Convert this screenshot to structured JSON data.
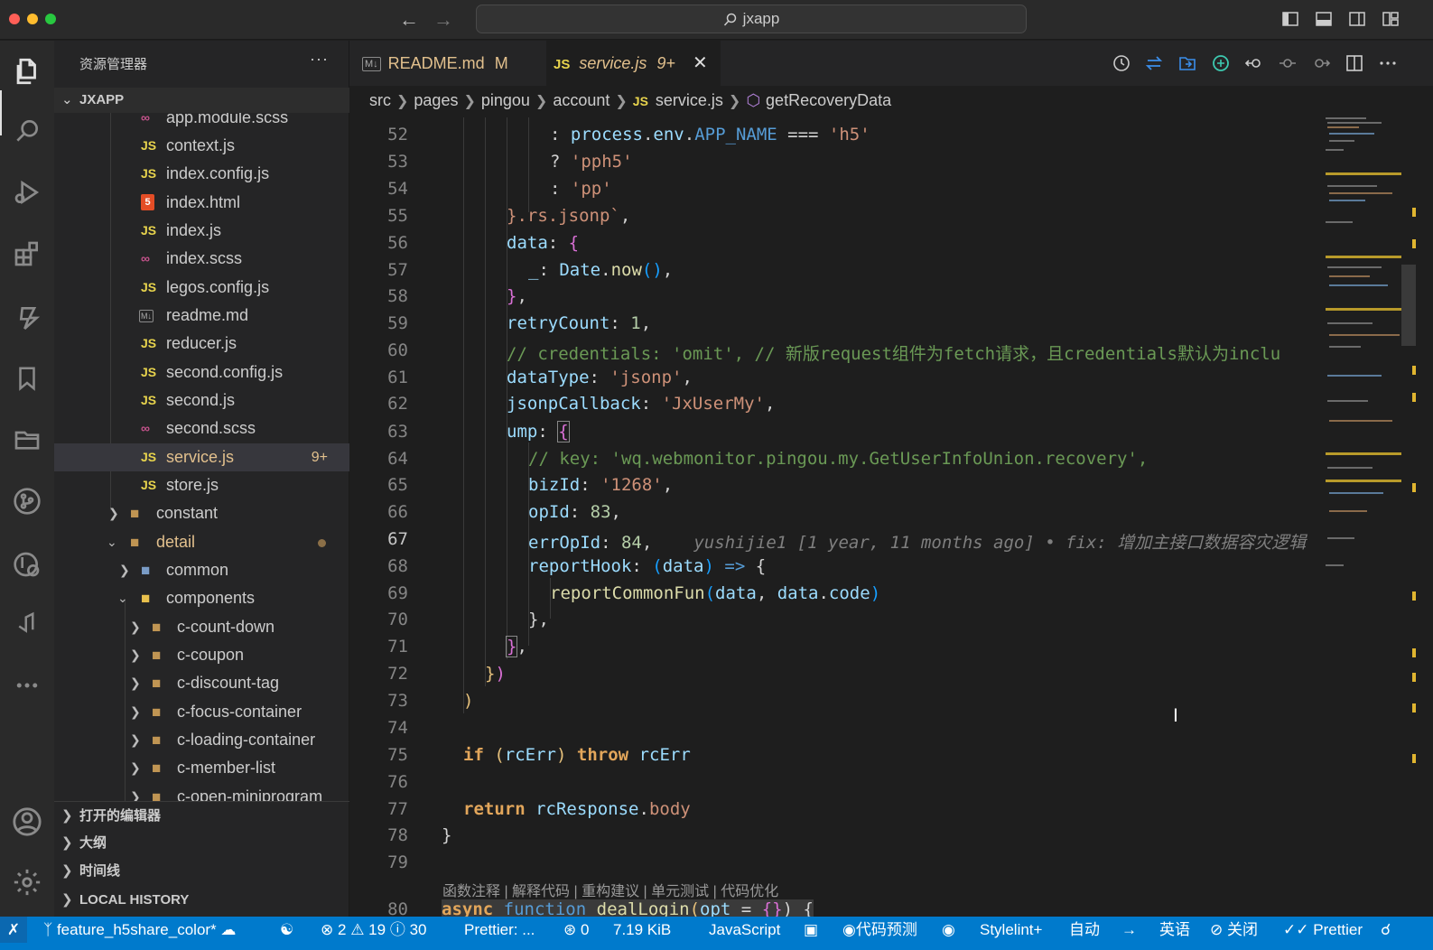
{
  "window": {
    "title": "jxapp"
  },
  "sidebar": {
    "title": "资源管理器",
    "more": "···",
    "root": "JXAPP",
    "tree": [
      {
        "label": "app.module.scss",
        "icon": "sass-icon"
      },
      {
        "label": "context.js",
        "icon": "js-file-icon",
        "icon_text": "JS"
      },
      {
        "label": "index.config.js",
        "icon": "js-file-icon",
        "icon_text": "JS"
      },
      {
        "label": "index.html",
        "icon": "html-file-icon"
      },
      {
        "label": "index.js",
        "icon": "js-file-icon",
        "icon_text": "JS"
      },
      {
        "label": "index.scss",
        "icon": "sass-icon"
      },
      {
        "label": "legos.config.js",
        "icon": "js-file-icon",
        "icon_text": "JS"
      },
      {
        "label": "readme.md",
        "icon": "markdown-icon"
      },
      {
        "label": "reducer.js",
        "icon": "js-file-icon",
        "icon_text": "JS"
      },
      {
        "label": "second.config.js",
        "icon": "js-file-icon",
        "icon_text": "JS"
      },
      {
        "label": "second.js",
        "icon": "js-file-icon",
        "icon_text": "JS"
      },
      {
        "label": "second.scss",
        "icon": "sass-icon"
      },
      {
        "label": "service.js",
        "icon": "js-file-icon",
        "icon_text": "JS",
        "badge": "9+",
        "selected": true
      },
      {
        "label": "store.js",
        "icon": "js-file-icon",
        "icon_text": "JS"
      },
      {
        "label": "constant",
        "icon": "folder-icon"
      },
      {
        "label": "detail",
        "icon": "folder-open-icon"
      },
      {
        "label": "common",
        "icon": "folder-icon"
      },
      {
        "label": "components",
        "icon": "folder-open-icon"
      },
      {
        "label": "c-count-down",
        "icon": "folder-icon"
      },
      {
        "label": "c-coupon",
        "icon": "folder-icon"
      },
      {
        "label": "c-discount-tag",
        "icon": "folder-icon"
      },
      {
        "label": "c-focus-container",
        "icon": "folder-icon"
      },
      {
        "label": "c-loading-container",
        "icon": "folder-icon"
      },
      {
        "label": "c-member-list",
        "icon": "folder-icon"
      },
      {
        "label": "c-open-miniprogram",
        "icon": "folder-icon"
      }
    ],
    "panels": [
      "打开的编辑器",
      "大纲",
      "时间线",
      "LOCAL HISTORY"
    ]
  },
  "tabs": [
    {
      "label": "README.md",
      "status": "M"
    },
    {
      "label": "service.js",
      "status": "9+",
      "close": "✕",
      "active": true
    }
  ],
  "breadcrumb": [
    "src",
    "pages",
    "pingou",
    "account",
    "service.js",
    "getRecoveryData"
  ],
  "editor": {
    "line_numbers": [
      "52",
      "53",
      "54",
      "55",
      "56",
      "57",
      "58",
      "59",
      "60",
      "61",
      "62",
      "63",
      "64",
      "65",
      "66",
      "67",
      "68",
      "69",
      "70",
      "71",
      "72",
      "73",
      "74",
      "75",
      "76",
      "77",
      "78",
      "79",
      "80"
    ],
    "current_line": "67",
    "code": {
      "l52": [
        ": ",
        "process",
        ".",
        "env",
        ".",
        "APP_NAME",
        " === ",
        "'h5'"
      ],
      "l53": [
        "? ",
        "'pph5'"
      ],
      "l54": [
        ": ",
        "'pp'"
      ],
      "l55": [
        "}.rs.jsonp`",
        ","
      ],
      "l56": [
        "data",
        ": ",
        "{"
      ],
      "l57": [
        "_",
        ": ",
        "Date",
        ".",
        "now",
        "()",
        ","
      ],
      "l58": [
        "}",
        ","
      ],
      "l59": [
        "retryCount",
        ": ",
        "1",
        ","
      ],
      "l60": "// credentials: 'omit', // 新版request组件为fetch请求，且credentials默认为inclu",
      "l61": [
        "dataType",
        ": ",
        "'jsonp'",
        ","
      ],
      "l62": [
        "jsonpCallback",
        ": ",
        "'JxUserMy'",
        ","
      ],
      "l63": [
        "ump",
        ": ",
        "{"
      ],
      "l64": "// key: 'wq.webmonitor.pingou.my.GetUserInfoUnion.recovery',",
      "l65": [
        "bizId",
        ": ",
        "'1268'",
        ","
      ],
      "l66": [
        "opId",
        ": ",
        "83",
        ","
      ],
      "l67": [
        "errOpId",
        ": ",
        "84",
        ","
      ],
      "l67_blame": "yushijie1 [1 year, 11 months ago] • fix: 增加主接口数据容灾逻辑",
      "l68": [
        "reportHook",
        ": ",
        "(",
        "data",
        ")",
        " => ",
        "{"
      ],
      "l69": [
        "reportCommonFun",
        "(",
        "data",
        ", ",
        "data",
        ".",
        "code",
        ")"
      ],
      "l70": [
        "}",
        ","
      ],
      "l71": [
        "}",
        ","
      ],
      "l72": [
        "}",
        ")"
      ],
      "l73": [
        ")"
      ],
      "l75": [
        "if",
        " ",
        "(",
        "rcErr",
        ")",
        " ",
        "throw",
        " ",
        "rcErr"
      ],
      "l77": [
        "return",
        " ",
        "rcResponse",
        ".",
        "body"
      ],
      "l78": [
        "}"
      ],
      "l80": [
        "async",
        " ",
        "function",
        " ",
        "dealLogin",
        "(",
        "opt",
        " = ",
        "{}",
        ") {"
      ]
    },
    "codelens": "函数注释 | 解释代码 | 重构建议 | 单元测试 | 代码优化"
  },
  "statusbar": {
    "branch": "feature_h5share_color*",
    "errors": "2",
    "warnings": "19",
    "infos": "30",
    "prettier_status": "Prettier: ...",
    "ports": "0",
    "file_size": "7.19 KiB",
    "language": "JavaScript",
    "code_predict": "代码预测",
    "stylelint": "Stylelint+",
    "auto": "自动",
    "lang_switch": "英语",
    "close_label": "关闭",
    "prettier": "Prettier"
  },
  "colors": {
    "accent": "#007acc",
    "modified": "#e2c08d",
    "js_icon": "#e8d44d"
  }
}
